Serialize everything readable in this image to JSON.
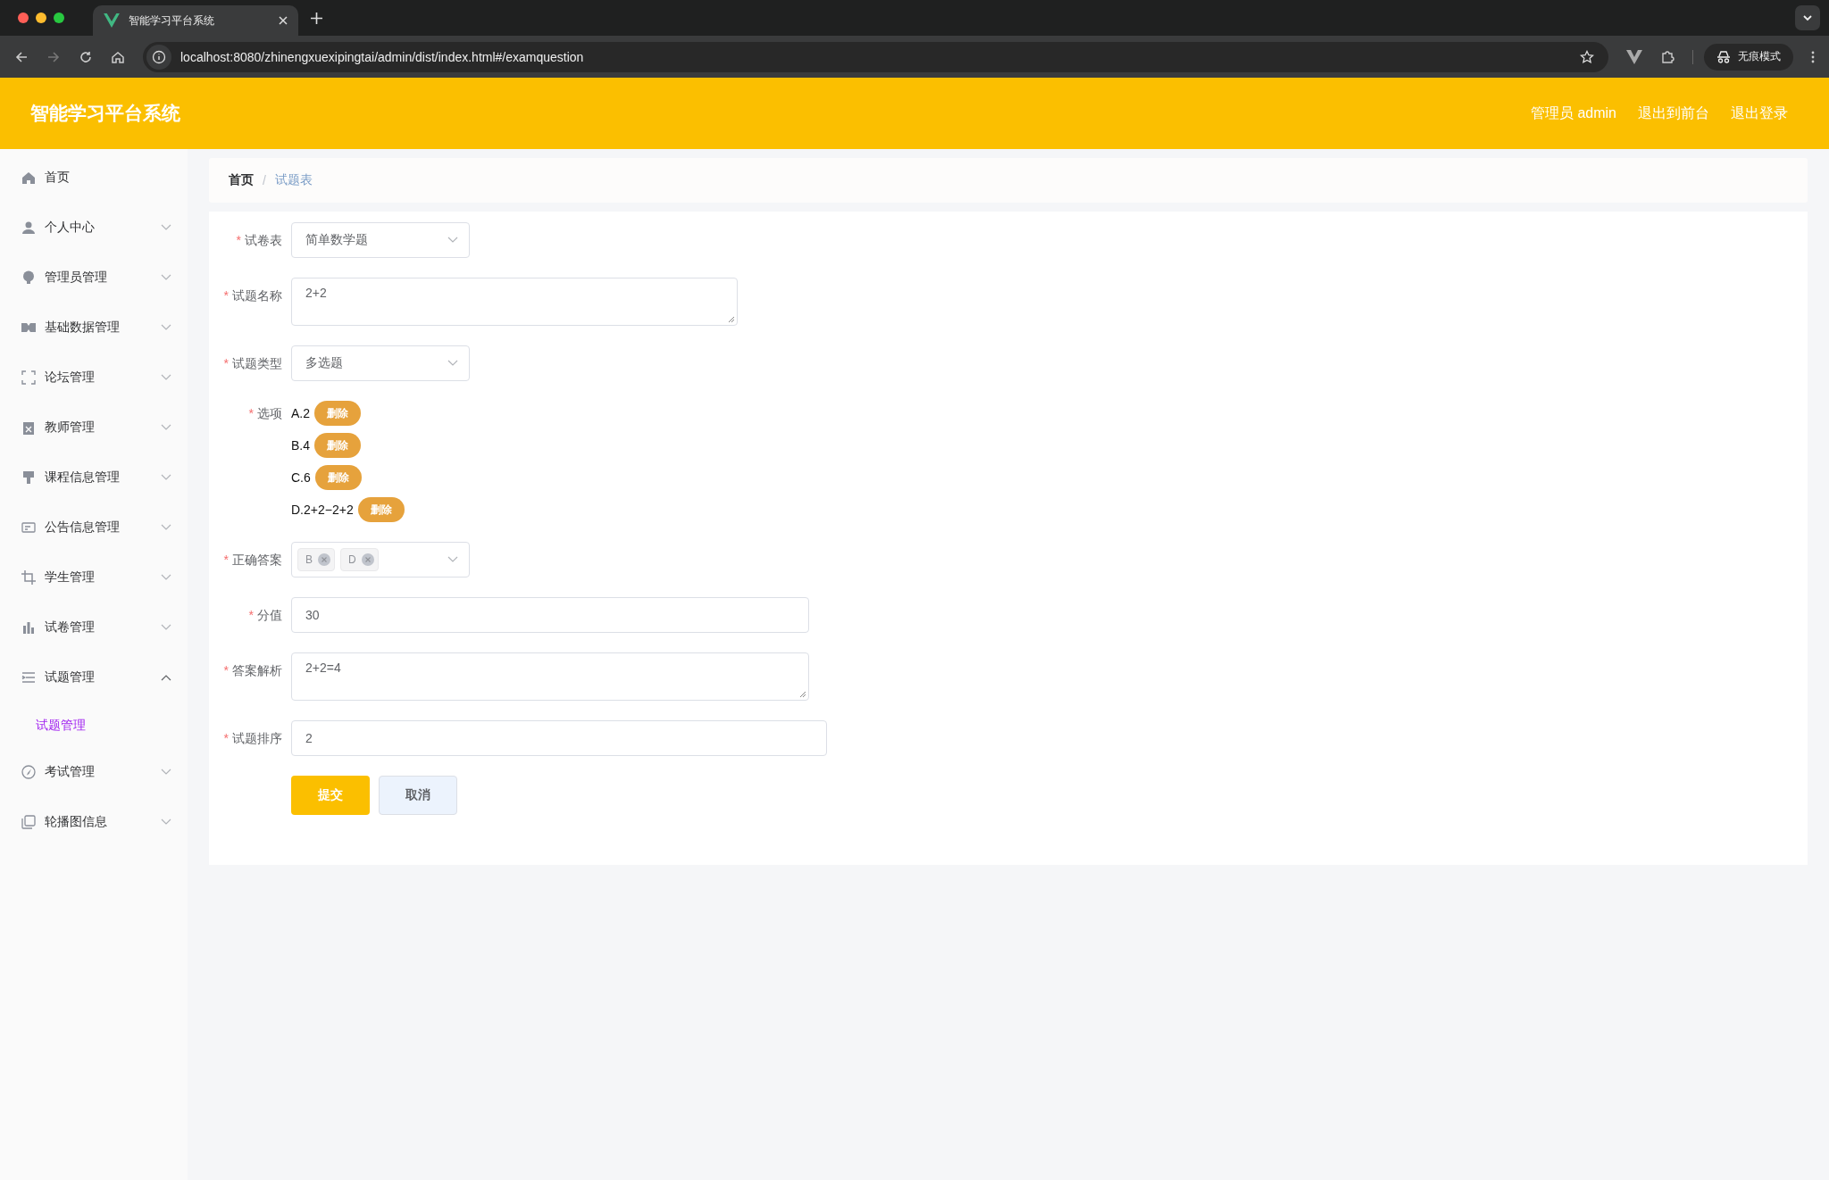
{
  "browser": {
    "tab_title": "智能学习平台系统",
    "url": "localhost:8080/zhinengxuexipingtai/admin/dist/index.html#/examquestion",
    "profile": "无痕模式"
  },
  "header": {
    "title": "智能学习平台系统",
    "links": [
      "管理员 admin",
      "退出到前台",
      "退出登录"
    ]
  },
  "sidebar": {
    "items": [
      {
        "label": "首页",
        "kind": "link"
      },
      {
        "label": "个人中心",
        "kind": "menu",
        "expanded": false
      },
      {
        "label": "管理员管理",
        "kind": "menu",
        "expanded": false
      },
      {
        "label": "基础数据管理",
        "kind": "menu",
        "expanded": false
      },
      {
        "label": "论坛管理",
        "kind": "menu",
        "expanded": false
      },
      {
        "label": "教师管理",
        "kind": "menu",
        "expanded": false
      },
      {
        "label": "课程信息管理",
        "kind": "menu",
        "expanded": false
      },
      {
        "label": "公告信息管理",
        "kind": "menu",
        "expanded": false
      },
      {
        "label": "学生管理",
        "kind": "menu",
        "expanded": false
      },
      {
        "label": "试卷管理",
        "kind": "menu",
        "expanded": false
      },
      {
        "label": "试题管理",
        "kind": "menu",
        "expanded": true,
        "children": [
          {
            "label": "试题管理",
            "selected": true
          }
        ]
      },
      {
        "label": "考试管理",
        "kind": "menu",
        "expanded": false
      },
      {
        "label": "轮播图信息",
        "kind": "menu",
        "expanded": false
      }
    ]
  },
  "breadcrumb": {
    "separator": "/",
    "items": [
      "首页",
      "试题表"
    ]
  },
  "form": {
    "fields": [
      {
        "label": "试卷表",
        "kind": "select",
        "required_mark": "*",
        "value": "简单数学题"
      },
      {
        "label": "试题名称",
        "kind": "textarea",
        "required_mark": "*",
        "value": "2+2"
      },
      {
        "label": "试题类型",
        "kind": "select",
        "required_mark": "*",
        "value": "多选题"
      },
      {
        "label": "选项",
        "kind": "options",
        "required_mark": "*",
        "options": [
          {
            "text": "A.2",
            "action": "删除"
          },
          {
            "text": "B.4",
            "action": "删除"
          },
          {
            "text": "C.6",
            "action": "删除"
          },
          {
            "text": "D.2+2−2+2",
            "action": "删除"
          }
        ]
      },
      {
        "label": "正确答案",
        "kind": "tags",
        "required_mark": "*",
        "tags": [
          "B",
          "D"
        ]
      },
      {
        "label": "分值",
        "kind": "input",
        "required_mark": "*",
        "value": "30"
      },
      {
        "label": "答案解析",
        "kind": "textarea",
        "required_mark": "*",
        "value": "2+2=4"
      },
      {
        "label": "试题排序",
        "kind": "input",
        "required_mark": "*",
        "value": "2"
      }
    ],
    "buttons": [
      {
        "label": "提交",
        "kind": "primary"
      },
      {
        "label": "取消",
        "kind": "default"
      }
    ]
  }
}
